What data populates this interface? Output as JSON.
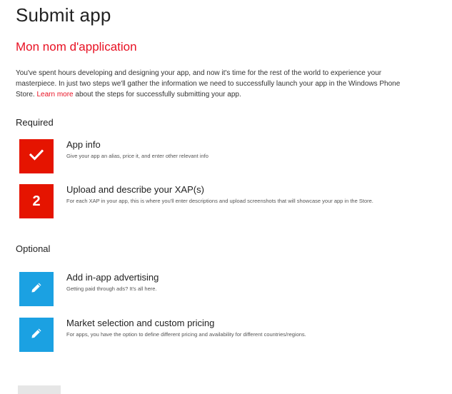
{
  "page": {
    "title": "Submit app",
    "app_name": "Mon nom d'application",
    "intro_before_link": "You've spent hours developing and designing your app, and now it's time for the rest of the world to experience your masterpiece. In just two steps we'll gather the information we need to successfully launch your app in the Windows Phone Store.",
    "intro_link": "Learn more",
    "intro_after_link": "about the steps for successfully submitting your app."
  },
  "required": {
    "label": "Required",
    "steps": [
      {
        "tile_icon": "checkmark-icon",
        "title": "App info",
        "description": "Give your app an alias, price it, and enter other relevant info"
      },
      {
        "tile_number": "2",
        "title": "Upload and describe your XAP(s)",
        "description": "For each XAP in your app, this is where you'll enter descriptions and upload screenshots that will showcase your app in the Store."
      }
    ]
  },
  "optional": {
    "label": "Optional",
    "steps": [
      {
        "tile_icon": "pencil-icon",
        "title": "Add in-app advertising",
        "description": "Getting paid through ads? It's all here."
      },
      {
        "tile_icon": "pencil-icon",
        "title": "Market selection and custom pricing",
        "description": "For apps, you have the option to define different pricing and availability for different countries/regions."
      }
    ]
  },
  "colors": {
    "accent_red": "#e51400",
    "accent_blue": "#1ba1e2",
    "link_red": "#e81123"
  }
}
